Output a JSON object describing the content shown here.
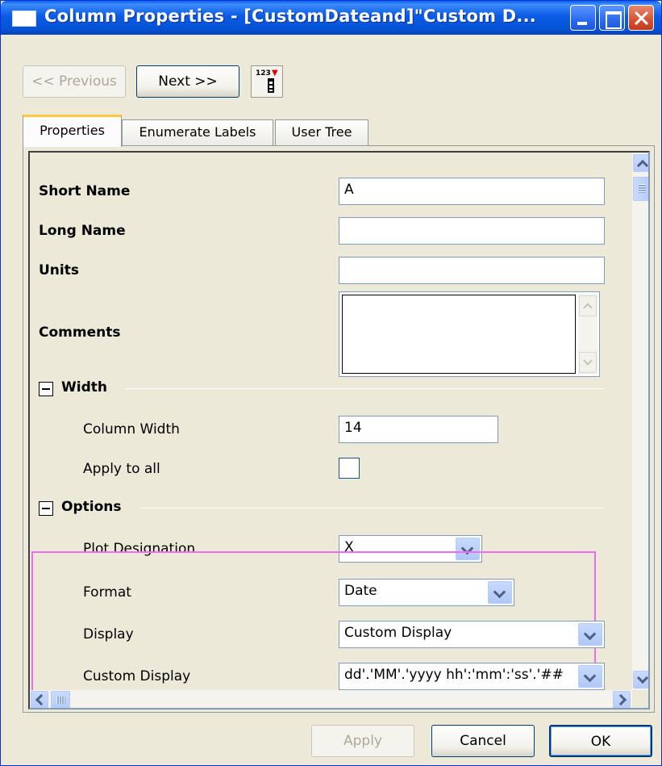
{
  "window": {
    "title": "Column Properties - [CustomDateand]\"Custom D...",
    "icons": {
      "app": "window-icon",
      "minimize": "minimize-icon",
      "maximize": "maximize-icon",
      "close": "close-icon"
    }
  },
  "toolbar": {
    "previous_label": "<< Previous",
    "next_label": "Next >>",
    "icon_num": "123",
    "icon_arrow": "▼",
    "icon_name": "column-info-icon"
  },
  "tabs": [
    {
      "label": "Properties",
      "active": true
    },
    {
      "label": "Enumerate Labels",
      "active": false
    },
    {
      "label": "User Tree",
      "active": false
    }
  ],
  "properties": {
    "short_name": {
      "label": "Short Name",
      "value": "A"
    },
    "long_name": {
      "label": "Long Name",
      "value": ""
    },
    "units": {
      "label": "Units",
      "value": ""
    },
    "comments": {
      "label": "Comments",
      "value": ""
    }
  },
  "width_section": {
    "title": "Width",
    "column_width": {
      "label": "Column Width",
      "value": "14"
    },
    "apply_to_all": {
      "label": "Apply to all",
      "checked": false
    }
  },
  "options_section": {
    "title": "Options",
    "plot_designation": {
      "label": "Plot Designation",
      "value": "X"
    },
    "format": {
      "label": "Format",
      "value": "Date"
    },
    "display": {
      "label": "Display",
      "value": "Custom Display"
    },
    "custom_display": {
      "label": "Custom Display",
      "value": "dd'.'MM'.'yyyy hh':'mm':'ss'.'##"
    }
  },
  "buttons": {
    "apply": "Apply",
    "cancel": "Cancel",
    "ok": "OK"
  },
  "colors": {
    "titlebar": "#0A5BE6",
    "highlight": "#F06BF0",
    "window_bg": "#ECE9D8"
  }
}
